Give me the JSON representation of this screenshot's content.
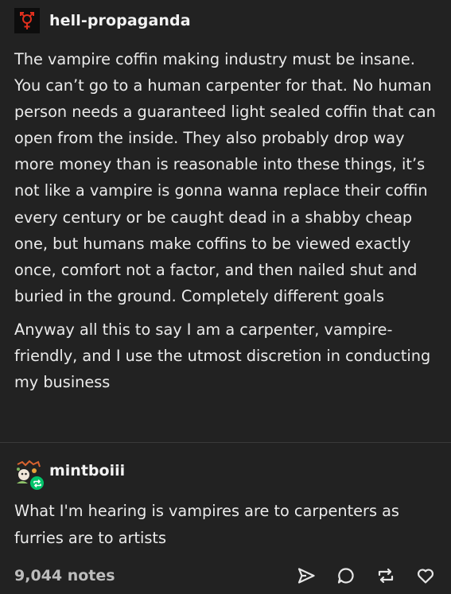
{
  "post": {
    "blog_name": "hell-propaganda",
    "avatar_icon": "venus-mars-symbol-icon",
    "paragraphs": [
      "The vampire coffin making industry must be insane. You can’t go to a human carpenter for that. No human person needs a guaranteed light sealed coffin that can open from the inside. They also probably drop way more money than is reasonable into these things, it’s not like a vampire is gonna wanna replace their coffin every century or be caught dead in a shabby cheap one, but humans make coffins to be viewed exactly once, comfort not a factor, and then nailed shut and buried in the ground. Completely different goals",
      "Anyway all this to say I am a carpenter, vampire-friendly, and I use the utmost discretion in conducting my business"
    ]
  },
  "reblog": {
    "blog_name": "mintboiii",
    "badge_icon": "reblog-icon",
    "text": "What I'm hearing is vampires are to carpenters as furries are to artists"
  },
  "footer": {
    "notes": "9,044 notes",
    "actions": [
      "share-icon",
      "reply-icon",
      "reblog-icon",
      "like-icon"
    ]
  },
  "colors": {
    "background": "#222222",
    "text": "#ebebeb",
    "muted": "#bdbdbd",
    "divider": "#3a3a3a",
    "avatar_accent": "#e0301e",
    "reblog_badge": "#00c46a"
  }
}
